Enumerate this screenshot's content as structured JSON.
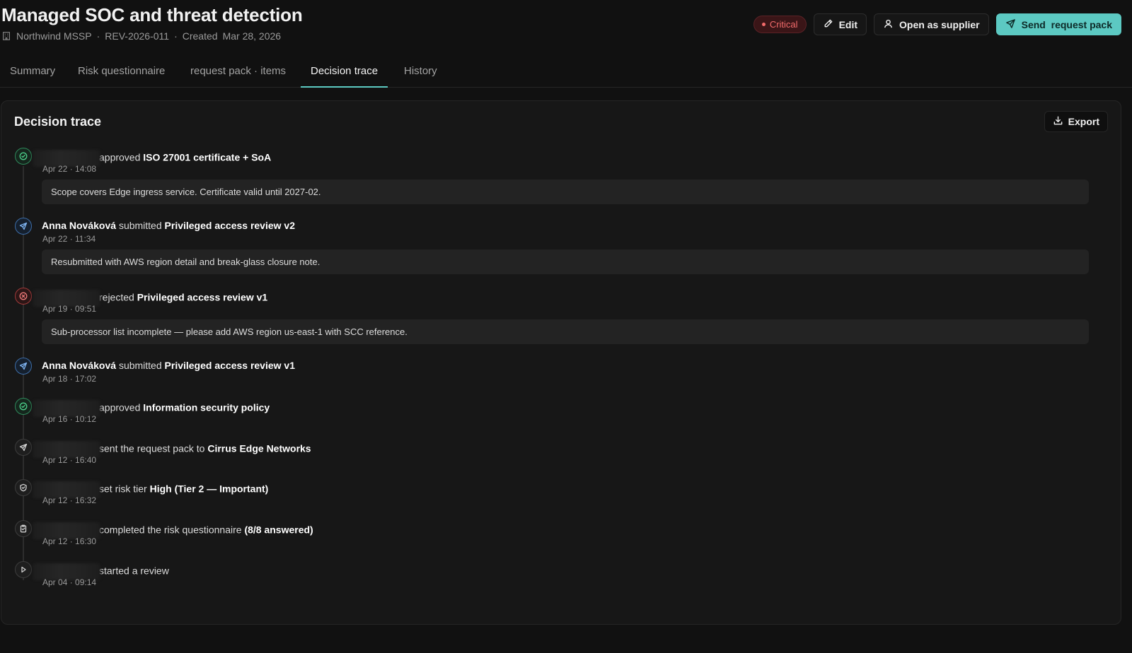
{
  "header": {
    "title": "Managed SOC and threat detection",
    "org": "Northwind MSSP",
    "ref": "REV-2026-011",
    "created_label": "Created",
    "created_date": "Mar 28, 2026",
    "separator": "·",
    "severity": "Critical",
    "edit_label": "Edit",
    "open_supplier_label": "Open as supplier",
    "send_label": "Send  request pack"
  },
  "tabs": [
    {
      "label": "Summary"
    },
    {
      "label": "Risk questionnaire"
    },
    {
      "label": "request pack · items"
    },
    {
      "label": "Decision trace"
    },
    {
      "label": "History"
    }
  ],
  "trace": {
    "title": "Decision trace",
    "export_label": "Export",
    "events": [
      {
        "icon": "check-circle-icon",
        "kind": "approved",
        "actor": "",
        "verb": "approved",
        "object": "ISO 27001 certificate + SoA",
        "time": "Apr 22 · 14:08",
        "note": "Scope covers Edge ingress service. Certificate valid until 2027-02."
      },
      {
        "icon": "send-icon",
        "kind": "submitted",
        "actor": "Anna Nováková",
        "verb": "submitted",
        "object": "Privileged access review v2",
        "time": "Apr 22 · 11:34",
        "note": "Resubmitted with AWS region detail and break-glass closure note."
      },
      {
        "icon": "x-circle-icon",
        "kind": "rejected",
        "actor": "",
        "verb": "rejected",
        "object": "Privileged access review v1",
        "time": "Apr 19 · 09:51",
        "note": "Sub-processor list incomplete — please add AWS region us-east-1 with SCC reference."
      },
      {
        "icon": "send-icon",
        "kind": "submitted",
        "actor": "Anna Nováková",
        "verb": "submitted",
        "object": "Privileged access review v1",
        "time": "Apr 18 · 17:02",
        "note": ""
      },
      {
        "icon": "check-circle-icon",
        "kind": "approved",
        "actor": "",
        "verb": "approved",
        "object": "Information security policy",
        "time": "Apr 16 · 10:12",
        "note": ""
      },
      {
        "icon": "send-icon",
        "kind": "neutral",
        "actor": "",
        "verb": "sent the request pack to",
        "object": "Cirrus Edge Networks",
        "time": "Apr 12 · 16:40",
        "note": ""
      },
      {
        "icon": "shield-icon",
        "kind": "neutral",
        "actor": "",
        "verb": "set risk tier",
        "object": "High (Tier 2 — Important)",
        "time": "Apr 12 · 16:32",
        "note": ""
      },
      {
        "icon": "clipboard-check-icon",
        "kind": "neutral",
        "actor": "",
        "verb": "completed the risk questionnaire",
        "object": "(8/8 answered)",
        "time": "Apr 12 · 16:30",
        "note": ""
      },
      {
        "icon": "play-icon",
        "kind": "neutral",
        "actor": "",
        "verb": "started a review",
        "object": "",
        "time": "Apr 04 · 09:14",
        "note": ""
      }
    ]
  },
  "colors": {
    "accent": "#5cc9c2",
    "critical": "#f26b6b",
    "approved": "#4ccf8a",
    "submitted": "#7eb2ee",
    "rejected": "#f07a7a"
  }
}
